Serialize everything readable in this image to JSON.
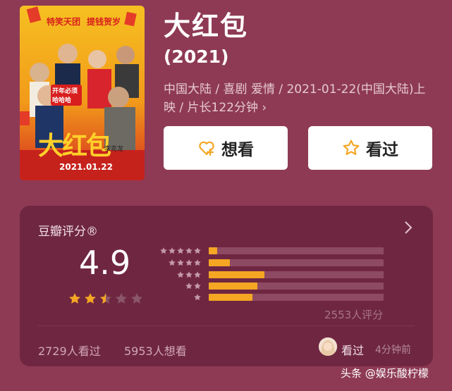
{
  "movie": {
    "title": "大红包",
    "year": "(2021)",
    "info": "中国大陆 / 喜剧 爱情 / 2021-01-22(中国大陆)上映 / 片长122分钟 ›",
    "poster": {
      "tagline_left": "特笑天团",
      "tagline_right": "提钱贺岁",
      "title": "大红包",
      "subtitle": "开年必须 哈哈哈",
      "director": "李克龙",
      "date": "2021.01.22"
    }
  },
  "actions": {
    "want_label": "想看",
    "seen_label": "看过"
  },
  "rating": {
    "label": "豆瓣评分®",
    "score": "4.9",
    "stars": 2.5,
    "distribution": [
      {
        "stars": 5,
        "fraction": 0.05
      },
      {
        "stars": 4,
        "fraction": 0.12
      },
      {
        "stars": 3,
        "fraction": 0.32
      },
      {
        "stars": 2,
        "fraction": 0.28
      },
      {
        "stars": 1,
        "fraction": 0.25
      }
    ],
    "count_text": "2553人评分"
  },
  "stats": {
    "seen": "2729人看过",
    "want": "5953人想看"
  },
  "recent": {
    "action": "看过",
    "time": "4分钟前"
  },
  "watermark": "头条 @娱乐酸柠檬",
  "colors": {
    "background": "#8e3a55",
    "card": "#6f2741",
    "accent": "#f5a623"
  }
}
